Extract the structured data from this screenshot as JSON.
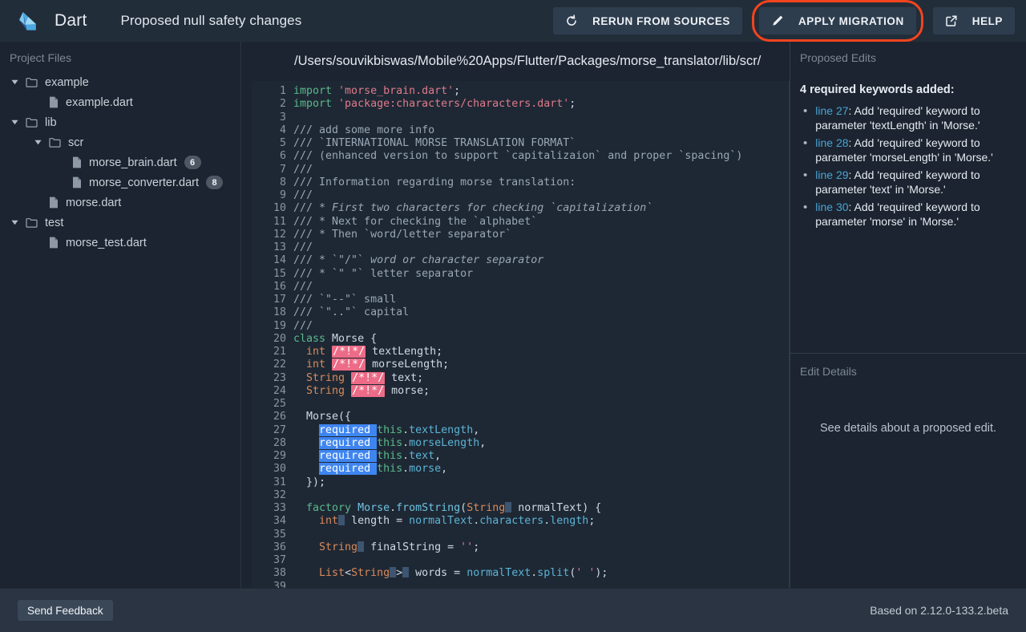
{
  "header": {
    "brand_name": "Dart",
    "logo_icon": "dart-logo-icon",
    "subtitle": "Proposed null safety changes",
    "buttons": [
      {
        "id": "rerun",
        "label": "RERUN FROM SOURCES",
        "icon": "refresh-icon"
      },
      {
        "id": "apply",
        "label": "APPLY MIGRATION",
        "icon": "pencil-icon",
        "highlighted": true
      },
      {
        "id": "help",
        "label": "HELP",
        "icon": "external-link-icon"
      }
    ],
    "highlight_color": "#f4441e"
  },
  "sidebar": {
    "title": "Project Files",
    "tree": [
      {
        "label": "example",
        "type": "folder",
        "depth": 0,
        "expanded": true,
        "badge": ""
      },
      {
        "label": "example.dart",
        "type": "file",
        "depth": 1,
        "expanded": null,
        "badge": ""
      },
      {
        "label": "lib",
        "type": "folder",
        "depth": 0,
        "expanded": true,
        "badge": ""
      },
      {
        "label": "scr",
        "type": "folder",
        "depth": 1,
        "expanded": true,
        "badge": ""
      },
      {
        "label": "morse_brain.dart",
        "type": "file",
        "depth": 2,
        "expanded": null,
        "badge": "6"
      },
      {
        "label": "morse_converter.dart",
        "type": "file",
        "depth": 2,
        "expanded": null,
        "badge": "8"
      },
      {
        "label": "morse.dart",
        "type": "file",
        "depth": 1,
        "expanded": null,
        "badge": ""
      },
      {
        "label": "test",
        "type": "folder",
        "depth": 0,
        "expanded": true,
        "badge": ""
      },
      {
        "label": "morse_test.dart",
        "type": "file",
        "depth": 1,
        "expanded": null,
        "badge": ""
      }
    ]
  },
  "editor": {
    "path": "/Users/souvikbiswas/Mobile%20Apps/Flutter/Packages/morse_translator/lib/scr/",
    "first_line": 1,
    "last_line": 39,
    "lines": [
      {
        "n": 1,
        "tokens": [
          {
            "t": "import ",
            "c": "kw"
          },
          {
            "t": "'morse_brain.dart'",
            "c": "str"
          },
          {
            "t": ";",
            "c": "plain"
          }
        ]
      },
      {
        "n": 2,
        "tokens": [
          {
            "t": "import ",
            "c": "kw"
          },
          {
            "t": "'package:characters/characters.dart'",
            "c": "str"
          },
          {
            "t": ";",
            "c": "plain"
          }
        ]
      },
      {
        "n": 3,
        "tokens": []
      },
      {
        "n": 4,
        "tokens": [
          {
            "t": "/// add some more info",
            "c": "com"
          }
        ]
      },
      {
        "n": 5,
        "tokens": [
          {
            "t": "/// `INTERNATIONAL MORSE TRANSLATION FORMAT`",
            "c": "com"
          }
        ]
      },
      {
        "n": 6,
        "tokens": [
          {
            "t": "/// (enhanced version to support `capitalizaion` and proper `spacing`)",
            "c": "com"
          }
        ]
      },
      {
        "n": 7,
        "tokens": [
          {
            "t": "///",
            "c": "com"
          }
        ]
      },
      {
        "n": 8,
        "tokens": [
          {
            "t": "/// Information regarding morse translation:",
            "c": "com"
          }
        ]
      },
      {
        "n": 9,
        "tokens": [
          {
            "t": "///",
            "c": "com"
          }
        ]
      },
      {
        "n": 10,
        "tokens": [
          {
            "t": "/// ",
            "c": "com"
          },
          {
            "t": "* First two characters for checking `capitalization`",
            "c": "comi"
          }
        ]
      },
      {
        "n": 11,
        "tokens": [
          {
            "t": "/// * Next for checking the `alphabet`",
            "c": "com"
          }
        ]
      },
      {
        "n": 12,
        "tokens": [
          {
            "t": "/// * Then `word/letter separator`",
            "c": "com"
          }
        ]
      },
      {
        "n": 13,
        "tokens": [
          {
            "t": "///",
            "c": "com"
          }
        ]
      },
      {
        "n": 14,
        "tokens": [
          {
            "t": "/// * `\"/\"` ",
            "c": "com"
          },
          {
            "t": "word or character separator",
            "c": "comi"
          }
        ]
      },
      {
        "n": 15,
        "tokens": [
          {
            "t": "/// * `\" \"` letter separator",
            "c": "com"
          }
        ]
      },
      {
        "n": 16,
        "tokens": [
          {
            "t": "///",
            "c": "com"
          }
        ]
      },
      {
        "n": 17,
        "tokens": [
          {
            "t": "/// `\"--\"` small",
            "c": "com"
          }
        ]
      },
      {
        "n": 18,
        "tokens": [
          {
            "t": "/// `\"..\"` capital",
            "c": "com"
          }
        ]
      },
      {
        "n": 19,
        "tokens": [
          {
            "t": "///",
            "c": "com"
          }
        ]
      },
      {
        "n": 20,
        "tokens": [
          {
            "t": "class ",
            "c": "kw"
          },
          {
            "t": "Morse",
            "c": "plain"
          },
          {
            "t": " {",
            "c": "plain"
          }
        ]
      },
      {
        "n": 21,
        "tokens": [
          {
            "t": "  ",
            "c": "plain"
          },
          {
            "t": "int",
            "c": "type"
          },
          {
            "t": " ",
            "c": "plain"
          },
          {
            "t": "/*!*/",
            "c": "hl-nn"
          },
          {
            "t": " textLength;",
            "c": "plain"
          }
        ]
      },
      {
        "n": 22,
        "tokens": [
          {
            "t": "  ",
            "c": "plain"
          },
          {
            "t": "int",
            "c": "type"
          },
          {
            "t": " ",
            "c": "plain"
          },
          {
            "t": "/*!*/",
            "c": "hl-nn"
          },
          {
            "t": " morseLength;",
            "c": "plain"
          }
        ]
      },
      {
        "n": 23,
        "tokens": [
          {
            "t": "  ",
            "c": "plain"
          },
          {
            "t": "String",
            "c": "type"
          },
          {
            "t": " ",
            "c": "plain"
          },
          {
            "t": "/*!*/",
            "c": "hl-nn"
          },
          {
            "t": " text;",
            "c": "plain"
          }
        ]
      },
      {
        "n": 24,
        "tokens": [
          {
            "t": "  ",
            "c": "plain"
          },
          {
            "t": "String",
            "c": "type"
          },
          {
            "t": " ",
            "c": "plain"
          },
          {
            "t": "/*!*/",
            "c": "hl-nn"
          },
          {
            "t": " morse;",
            "c": "plain"
          }
        ]
      },
      {
        "n": 25,
        "tokens": []
      },
      {
        "n": 26,
        "tokens": [
          {
            "t": "  Morse({",
            "c": "plain"
          }
        ]
      },
      {
        "n": 27,
        "tokens": [
          {
            "t": "    ",
            "c": "plain"
          },
          {
            "t": "required ",
            "c": "hl-req"
          },
          {
            "t": "this",
            "c": "kw"
          },
          {
            "t": ".",
            "c": "plain"
          },
          {
            "t": "textLength",
            "c": "prop"
          },
          {
            "t": ",",
            "c": "plain"
          }
        ]
      },
      {
        "n": 28,
        "tokens": [
          {
            "t": "    ",
            "c": "plain"
          },
          {
            "t": "required ",
            "c": "hl-req"
          },
          {
            "t": "this",
            "c": "kw"
          },
          {
            "t": ".",
            "c": "plain"
          },
          {
            "t": "morseLength",
            "c": "prop"
          },
          {
            "t": ",",
            "c": "plain"
          }
        ]
      },
      {
        "n": 29,
        "tokens": [
          {
            "t": "    ",
            "c": "plain"
          },
          {
            "t": "required ",
            "c": "hl-req"
          },
          {
            "t": "this",
            "c": "kw"
          },
          {
            "t": ".",
            "c": "plain"
          },
          {
            "t": "text",
            "c": "prop"
          },
          {
            "t": ",",
            "c": "plain"
          }
        ]
      },
      {
        "n": 30,
        "tokens": [
          {
            "t": "    ",
            "c": "plain"
          },
          {
            "t": "required ",
            "c": "hl-req"
          },
          {
            "t": "this",
            "c": "kw"
          },
          {
            "t": ".",
            "c": "plain"
          },
          {
            "t": "morse",
            "c": "prop"
          },
          {
            "t": ",",
            "c": "plain"
          }
        ]
      },
      {
        "n": 31,
        "tokens": [
          {
            "t": "  });",
            "c": "plain"
          }
        ]
      },
      {
        "n": 32,
        "tokens": []
      },
      {
        "n": 33,
        "tokens": [
          {
            "t": "  ",
            "c": "plain"
          },
          {
            "t": "factory ",
            "c": "kw"
          },
          {
            "t": "Morse",
            "c": "cls"
          },
          {
            "t": ".",
            "c": "plain"
          },
          {
            "t": "fromString",
            "c": "cls"
          },
          {
            "t": "(",
            "c": "plain"
          },
          {
            "t": "String",
            "c": "type"
          },
          {
            "t": "",
            "c": "hl-blank"
          },
          {
            "t": " normalText) {",
            "c": "plain"
          }
        ]
      },
      {
        "n": 34,
        "tokens": [
          {
            "t": "    ",
            "c": "plain"
          },
          {
            "t": "int",
            "c": "type"
          },
          {
            "t": "",
            "c": "hl-blank"
          },
          {
            "t": " length = ",
            "c": "plain"
          },
          {
            "t": "normalText",
            "c": "prop"
          },
          {
            "t": ".",
            "c": "plain"
          },
          {
            "t": "characters",
            "c": "prop"
          },
          {
            "t": ".",
            "c": "plain"
          },
          {
            "t": "length",
            "c": "prop"
          },
          {
            "t": ";",
            "c": "plain"
          }
        ]
      },
      {
        "n": 35,
        "tokens": []
      },
      {
        "n": 36,
        "tokens": [
          {
            "t": "    ",
            "c": "plain"
          },
          {
            "t": "String",
            "c": "type"
          },
          {
            "t": "",
            "c": "hl-blank"
          },
          {
            "t": " finalString = ",
            "c": "plain"
          },
          {
            "t": "''",
            "c": "str"
          },
          {
            "t": ";",
            "c": "plain"
          }
        ]
      },
      {
        "n": 37,
        "tokens": []
      },
      {
        "n": 38,
        "tokens": [
          {
            "t": "    ",
            "c": "plain"
          },
          {
            "t": "List",
            "c": "type"
          },
          {
            "t": "<",
            "c": "plain"
          },
          {
            "t": "String",
            "c": "type"
          },
          {
            "t": "",
            "c": "hl-blank"
          },
          {
            "t": ">",
            "c": "plain"
          },
          {
            "t": "",
            "c": "hl-blank"
          },
          {
            "t": " words = ",
            "c": "plain"
          },
          {
            "t": "normalText",
            "c": "prop"
          },
          {
            "t": ".",
            "c": "plain"
          },
          {
            "t": "split",
            "c": "prop"
          },
          {
            "t": "(",
            "c": "plain"
          },
          {
            "t": "' '",
            "c": "str"
          },
          {
            "t": ");",
            "c": "plain"
          }
        ]
      },
      {
        "n": 39,
        "tokens": []
      }
    ]
  },
  "right_panel": {
    "proposed_edits_title": "Proposed Edits",
    "summary": "4 required keywords added:",
    "edits": [
      {
        "line_label": "line 27",
        "text": ": Add 'required' keyword to parameter 'textLength' in 'Morse.'"
      },
      {
        "line_label": "line 28",
        "text": ": Add 'required' keyword to parameter 'morseLength' in 'Morse.'"
      },
      {
        "line_label": "line 29",
        "text": ": Add 'required' keyword to parameter 'text' in 'Morse.'"
      },
      {
        "line_label": "line 30",
        "text": ": Add 'required' keyword to parameter 'morse' in 'Morse.'"
      }
    ],
    "edit_details_title": "Edit Details",
    "edit_details_empty": "See details about a proposed edit."
  },
  "footer": {
    "feedback_label": "Send Feedback",
    "version": "Based on 2.12.0-133.2.beta"
  }
}
